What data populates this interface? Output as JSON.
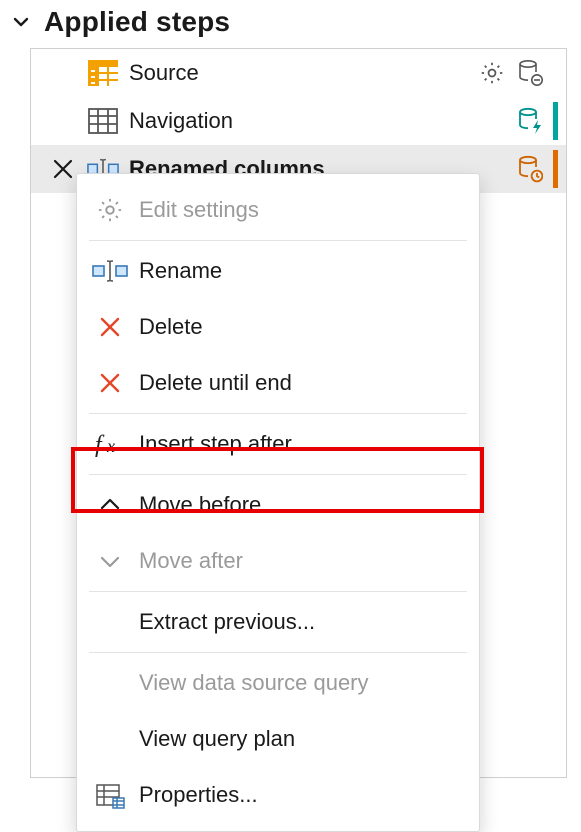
{
  "header": {
    "title": "Applied steps"
  },
  "steps": [
    {
      "label": "Source"
    },
    {
      "label": "Navigation"
    },
    {
      "label": "Renamed columns"
    }
  ],
  "menu": {
    "edit_settings": "Edit settings",
    "rename": "Rename",
    "delete": "Delete",
    "delete_until_end": "Delete until end",
    "insert_step_after": "Insert step after",
    "move_before": "Move before",
    "move_after": "Move after",
    "extract_previous": "Extract previous...",
    "view_data_source_query": "View data source query",
    "view_query_plan": "View query plan",
    "properties": "Properties..."
  }
}
